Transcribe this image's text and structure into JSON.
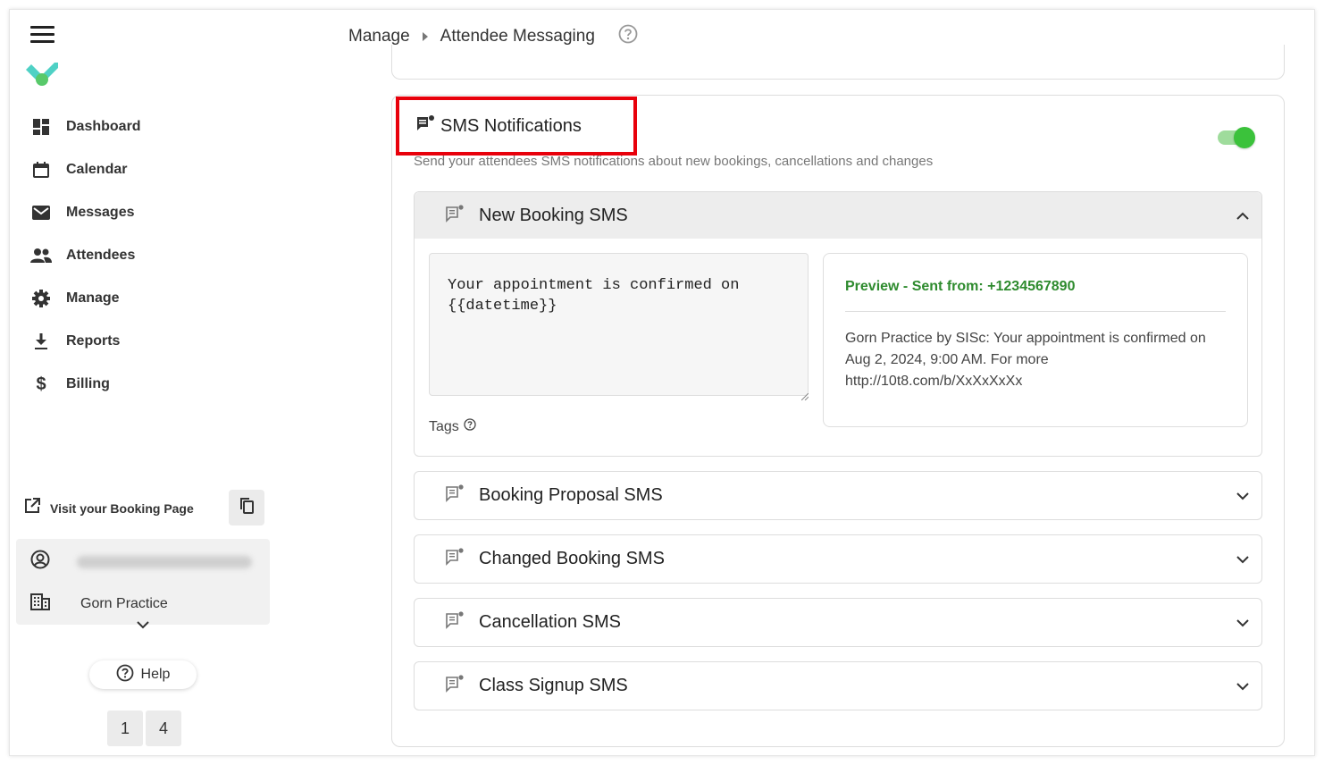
{
  "breadcrumb": {
    "parent": "Manage",
    "current": "Attendee Messaging"
  },
  "sidebar": {
    "items": [
      {
        "label": "Dashboard",
        "icon": "dashboard-icon"
      },
      {
        "label": "Calendar",
        "icon": "calendar-icon"
      },
      {
        "label": "Messages",
        "icon": "envelope-icon"
      },
      {
        "label": "Attendees",
        "icon": "people-icon"
      },
      {
        "label": "Manage",
        "icon": "gear-icon"
      },
      {
        "label": "Reports",
        "icon": "download-icon"
      },
      {
        "label": "Billing",
        "icon": "dollar-icon"
      }
    ],
    "visit_label": "Visit your Booking Page",
    "org_name": "Gorn Practice",
    "help_label": "Help",
    "digits": [
      "1",
      "4"
    ]
  },
  "sms": {
    "title": "SMS Notifications",
    "subtitle": "Send your attendees SMS notifications about new bookings, cancellations and changes",
    "enabled": true,
    "colors": {
      "toggle": "#3bc23b",
      "highlight": "#e8000b",
      "preview_header": "#2e8b2e"
    }
  },
  "new_booking": {
    "title": "New Booking SMS",
    "message": "Your appointment is confirmed on\n{{datetime}}",
    "tags_label": "Tags",
    "preview_header": "Preview - Sent from: +1234567890",
    "preview_body": "Gorn Practice by SISc: Your appointment is confirmed on Aug 2, 2024, 9:00 AM. For more http://10t8.com/b/XxXxXxXx"
  },
  "sections": [
    {
      "title": "Booking Proposal SMS"
    },
    {
      "title": "Changed Booking SMS"
    },
    {
      "title": "Cancellation SMS"
    },
    {
      "title": "Class Signup SMS"
    }
  ]
}
